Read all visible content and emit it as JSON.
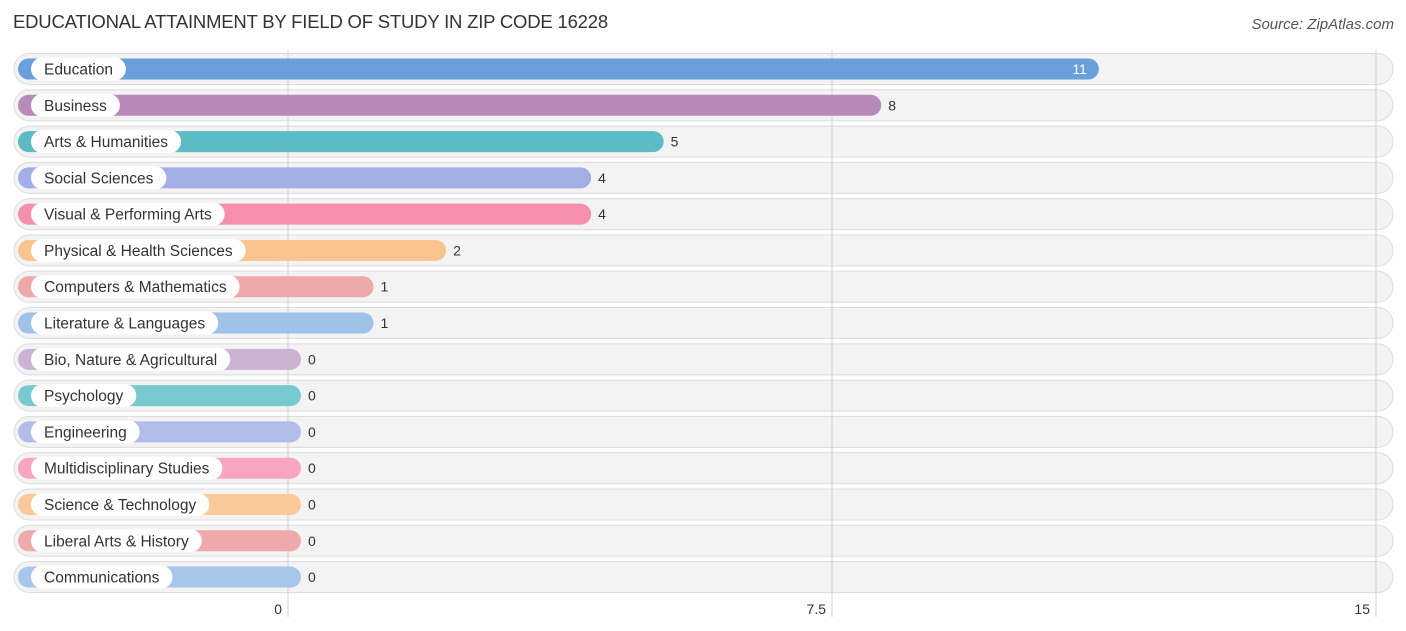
{
  "header": {
    "title": "EDUCATIONAL ATTAINMENT BY FIELD OF STUDY IN ZIP CODE 16228",
    "source": "Source: ZipAtlas.com"
  },
  "chart_data": {
    "type": "bar",
    "orientation": "horizontal",
    "title": "EDUCATIONAL ATTAINMENT BY FIELD OF STUDY IN ZIP CODE 16228",
    "xlabel": "",
    "ylabel": "",
    "xlim": [
      0,
      15
    ],
    "ticks": [
      0,
      7.5,
      15
    ],
    "tick_labels": [
      "0",
      "7.5",
      "15"
    ],
    "grid": true,
    "categories": [
      "Education",
      "Business",
      "Arts & Humanities",
      "Social Sciences",
      "Visual & Performing Arts",
      "Physical & Health Sciences",
      "Computers & Mathematics",
      "Literature & Languages",
      "Bio, Nature & Agricultural",
      "Psychology",
      "Engineering",
      "Multidisciplinary Studies",
      "Science & Technology",
      "Liberal Arts & History",
      "Communications"
    ],
    "values": [
      11,
      8,
      5,
      4,
      4,
      2,
      1,
      1,
      0,
      0,
      0,
      0,
      0,
      0,
      0
    ],
    "value_labels": [
      "11",
      "8",
      "5",
      "4",
      "4",
      "2",
      "1",
      "1",
      "0",
      "0",
      "0",
      "0",
      "0",
      "0",
      "0"
    ],
    "colors": [
      "#6a9fdc",
      "#b78ab9",
      "#5bbcc6",
      "#a4aee6",
      "#f48fae",
      "#f9c490",
      "#eda8a8",
      "#9fc2e9",
      "#cdb3d3",
      "#78cad0",
      "#b3bde9",
      "#f7a5c0",
      "#f9c99a",
      "#eeaaaa",
      "#a7c6ea"
    ]
  }
}
